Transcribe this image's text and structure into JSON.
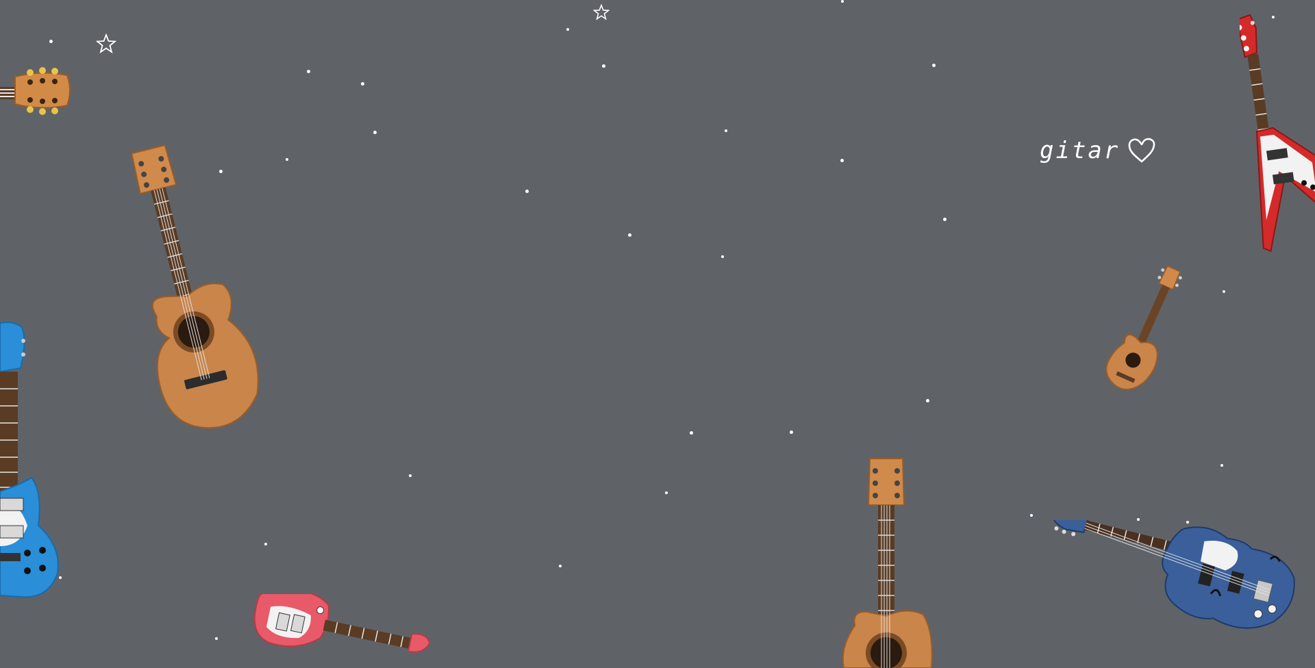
{
  "wallpaper": {
    "caption": "gitar",
    "caption_icon": "heart-outline-icon",
    "background_color": "#5f6368",
    "decorations": [
      "sparkle-dot",
      "star-outline-icon"
    ],
    "guitars": [
      "acoustic-guitar-headstock-icon",
      "acoustic-guitar-icon",
      "blue-electric-guitar-icon",
      "pink-electric-guitar-icon",
      "acoustic-guitar-icon",
      "ukulele-icon",
      "red-flying-v-guitar-icon",
      "blue-hollow-body-guitar-icon"
    ]
  }
}
